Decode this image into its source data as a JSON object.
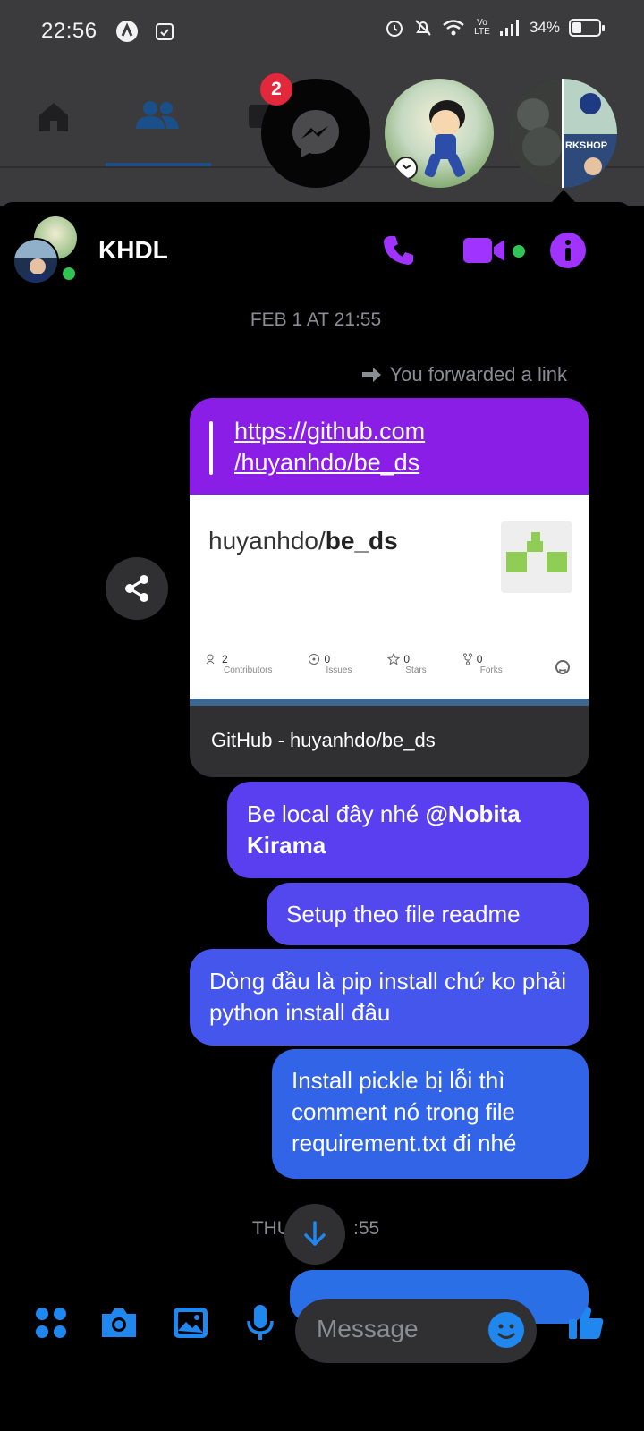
{
  "status_bar": {
    "time": "22:56",
    "battery_percent": "34%",
    "battery_level": 0.34,
    "network_label": "Vo LTE"
  },
  "background_app": {
    "tabs": [
      "home-icon",
      "friends-icon"
    ],
    "active_tab": "friends"
  },
  "chat_heads": {
    "messenger_badge": "2"
  },
  "chat": {
    "title": "KHDL",
    "accent_color": "#a033ff",
    "timestamp_1": "FEB 1 AT 21:55",
    "forward_note": "You forwarded a link",
    "link": {
      "url_line1": "https://github.com",
      "url_line2": "/huyanhdo/be_ds",
      "preview_owner": "huyanhdo/",
      "preview_repo": "be_ds",
      "stats": [
        {
          "value": "2",
          "label": "Contributors"
        },
        {
          "value": "0",
          "label": "Issues"
        },
        {
          "value": "0",
          "label": "Stars"
        },
        {
          "value": "0",
          "label": "Forks"
        }
      ],
      "footer_title": "GitHub - huyanhdo/be_ds"
    },
    "messages": [
      {
        "text_before": "Be local đây nhé ",
        "mention": "@Nobita Kirama"
      },
      {
        "text": "Setup theo file readme"
      },
      {
        "text": "Dòng đầu là pip install chứ ko phải python install đâu"
      },
      {
        "text": "Install pickle bị lỗi thì comment nó trong file requirement.txt đi nhé"
      }
    ],
    "timestamp_2_visible": "THU",
    "timestamp_2_tail": ":55"
  },
  "composer": {
    "placeholder": "Message"
  }
}
